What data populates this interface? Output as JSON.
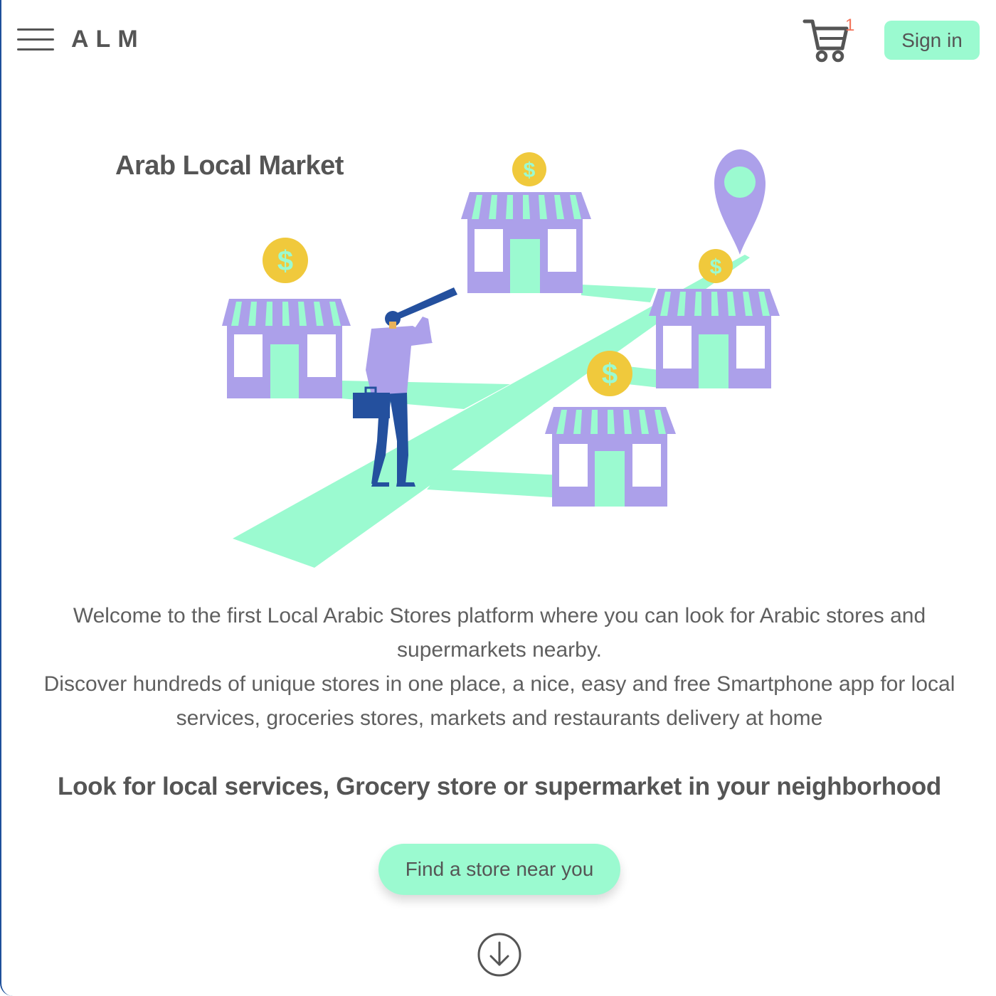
{
  "header": {
    "brand": "ALM",
    "cart_count": "1",
    "signin_label": "Sign in"
  },
  "hero": {
    "title": "Arab Local Market",
    "intro_line1": "Welcome to the first Local Arabic Stores platform where you can look for Arabic stores and supermarkets nearby.",
    "intro_line2": "Discover hundreds of unique stores in one place, a nice, easy and free Smartphone app for local services, groceries stores, markets and restaurants delivery at home",
    "tagline": "Look for local services, Grocery store or supermarket in your neighborhood",
    "cta_label": "Find a store near you"
  },
  "icons": {
    "menu": "hamburger-menu-icon",
    "cart": "shopping-cart-icon",
    "scroll": "arrow-down-circle-icon",
    "pin": "location-pin-icon",
    "coin": "dollar-coin-icon"
  },
  "colors": {
    "accent": "#9bfad0",
    "purple": "#aca0ea",
    "gold": "#f0c93c",
    "navy": "#1e4f9a",
    "badge": "#f2735a",
    "text": "#5f5f5f"
  }
}
